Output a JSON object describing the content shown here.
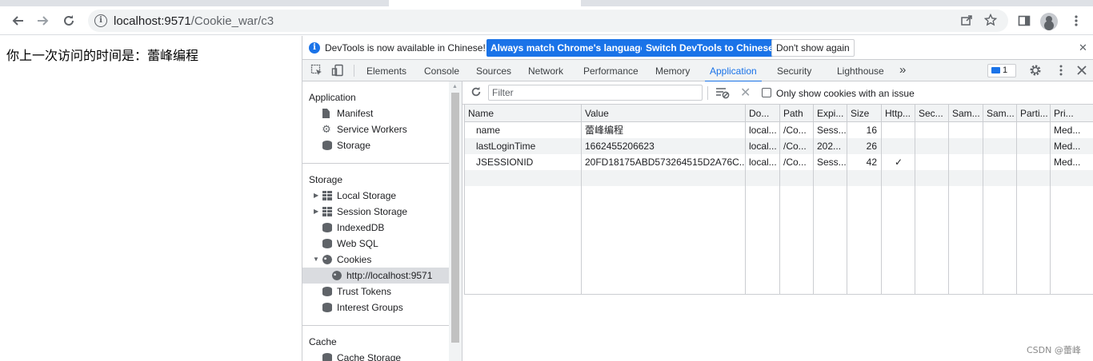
{
  "browser": {
    "url_host": "localhost:9571",
    "url_path": "/Cookie_war/c3",
    "icons": [
      "back-arrow-icon",
      "forward-arrow-icon",
      "reload-icon",
      "site-info-icon",
      "share-icon",
      "bookmark-star-icon",
      "side-panel-icon",
      "profile-avatar-icon",
      "kebab-menu-icon"
    ]
  },
  "page": {
    "text": "你上一次访问的时间是：蕾峰编程"
  },
  "devtools": {
    "infobar": {
      "message": "DevTools is now available in Chinese!",
      "btn_match": "Always match Chrome's language",
      "btn_switch": "Switch DevTools to Chinese",
      "btn_dismiss": "Don't show again"
    },
    "tabs": [
      "Elements",
      "Console",
      "Sources",
      "Network",
      "Performance",
      "Memory",
      "Application",
      "Security",
      "Lighthouse"
    ],
    "active_tab": "Application",
    "more_tabs": "»",
    "issues_count": "1",
    "sidebar": {
      "application_header": "Application",
      "application_items": [
        "Manifest",
        "Service Workers",
        "Storage"
      ],
      "storage_header": "Storage",
      "storage_items": [
        "Local Storage",
        "Session Storage",
        "IndexedDB",
        "Web SQL",
        "Cookies"
      ],
      "cookies_child": "http://localhost:9571",
      "storage_items_after": [
        "Trust Tokens",
        "Interest Groups"
      ],
      "cache_header": "Cache",
      "cache_items": [
        "Cache Storage"
      ]
    },
    "cookies": {
      "filter_placeholder": "Filter",
      "only_issues_label": "Only show cookies with an issue",
      "columns": [
        "Name",
        "Value",
        "Do...",
        "Path",
        "Expi...",
        "Size",
        "Http...",
        "Sec...",
        "Sam...",
        "Sam...",
        "Parti...",
        "Pri..."
      ],
      "rows": [
        [
          "name",
          "蕾峰编程",
          "local...",
          "/Co...",
          "Sess...",
          "16",
          "",
          "",
          "",
          "",
          "",
          "Med..."
        ],
        [
          "lastLoginTime",
          "1662455206623",
          "local...",
          "/Co...",
          "202...",
          "26",
          "",
          "",
          "",
          "",
          "",
          "Med..."
        ],
        [
          "JSESSIONID",
          "20FD18175ABD573264515D2A76C...",
          "local...",
          "/Co...",
          "Sess...",
          "42",
          "✓",
          "",
          "",
          "",
          "",
          "Med..."
        ]
      ]
    }
  },
  "watermark": "CSDN @蕾峰",
  "colors": {
    "accent": "#1a73e8",
    "toolbar_bg": "#f1f3f4",
    "border": "#cbcdd1"
  }
}
